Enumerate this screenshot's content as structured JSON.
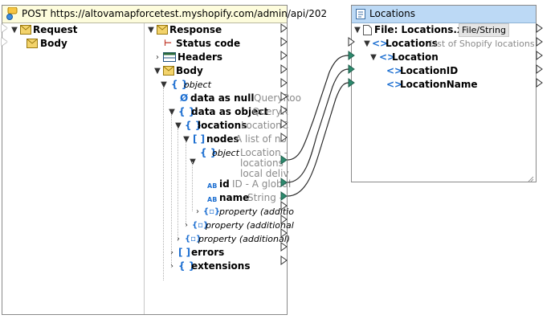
{
  "api_component": {
    "title": "POST https://altovamapforcetest.myshopify.com/admin/api/202",
    "request": {
      "label": "Request",
      "body": "Body"
    },
    "response": {
      "label": "Response",
      "status_code": "Status code",
      "headers": "Headers",
      "body": "Body",
      "object": "object",
      "data_null": "data as null",
      "data_null_type": "QueryRoo",
      "data_object": "data as object",
      "data_object_type": "QueryR",
      "locations": "locations",
      "locations_type": "LocationC",
      "nodes": "nodes",
      "nodes_desc": "A list of no",
      "node_object": "object",
      "node_desc_1": "Location -",
      "node_desc_2": "locations",
      "node_desc_3": "local deliv",
      "id_label": "id",
      "id_desc": "ID - A global",
      "name_label": "name",
      "name_desc": "String -",
      "prop_additional_1": "property (additio",
      "prop_additional_2": "property (additional",
      "prop_additional_3": "property (additional)",
      "errors": "errors",
      "extensions": "extensions",
      "abc_tag": "AB"
    }
  },
  "xml_component": {
    "title": "Locations",
    "file_label": "File: Locations.xml",
    "file_button": "File/String",
    "locations": "Locations",
    "locations_desc": "List of Shopify locations",
    "location": "Location",
    "location_id": "LocationID",
    "location_name": "LocationName"
  },
  "colors": {
    "api_title_bg": "#fdfcdc",
    "xml_title_bg": "#bcd9f5",
    "accent_blue": "#1d6fd1",
    "connector": "#2b2b2b",
    "port_connected": "#2d8a6e"
  }
}
